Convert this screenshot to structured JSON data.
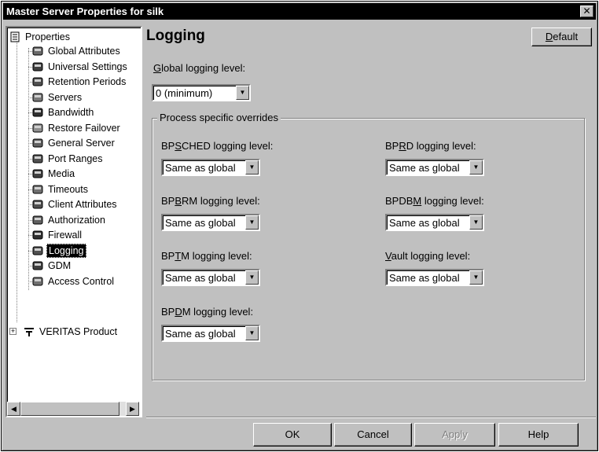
{
  "window": {
    "title": "Master Server Properties for silk",
    "close_glyph": "✕"
  },
  "tree": {
    "root": "Properties",
    "items": [
      {
        "label": "Global Attributes",
        "icon": "globe-icon"
      },
      {
        "label": "Universal Settings",
        "icon": "settings-icon"
      },
      {
        "label": "Retention Periods",
        "icon": "clock-icon"
      },
      {
        "label": "Servers",
        "icon": "server-icon"
      },
      {
        "label": "Bandwidth",
        "icon": "bandwidth-icon"
      },
      {
        "label": "Restore Failover",
        "icon": "restore-icon"
      },
      {
        "label": "General Server",
        "icon": "server-icon"
      },
      {
        "label": "Port Ranges",
        "icon": "port-icon"
      },
      {
        "label": "Media",
        "icon": "media-icon"
      },
      {
        "label": "Timeouts",
        "icon": "timer-icon"
      },
      {
        "label": "Client Attributes",
        "icon": "client-icon"
      },
      {
        "label": "Authorization",
        "icon": "key-icon"
      },
      {
        "label": "Firewall",
        "icon": "firewall-icon"
      },
      {
        "label": "Logging",
        "icon": "log-icon",
        "selected": true
      },
      {
        "label": "GDM",
        "icon": "gdm-icon"
      },
      {
        "label": "Access Control",
        "icon": "lock-icon"
      }
    ],
    "veritas": "VERITAS Product",
    "expander": "+"
  },
  "page": {
    "heading": "Logging",
    "default_button": {
      "pre": "",
      "accel": "D",
      "post": "efault"
    },
    "global_label": {
      "pre": "",
      "accel": "G",
      "post": "lobal logging level:"
    },
    "global_value": "0 (minimum)",
    "group_title": "Process specific overrides",
    "overrides": [
      {
        "pre": "BP",
        "accel": "S",
        "post": "CHED logging level:",
        "value": "Same as global"
      },
      {
        "pre": "BP",
        "accel": "R",
        "post": "D logging level:",
        "value": "Same as global"
      },
      {
        "pre": "BP",
        "accel": "B",
        "post": "RM logging level:",
        "value": "Same as global"
      },
      {
        "pre": "BPDB",
        "accel": "M",
        "post": " logging level:",
        "value": "Same as global"
      },
      {
        "pre": "BP",
        "accel": "T",
        "post": "M logging level:",
        "value": "Same as global"
      },
      {
        "pre": "",
        "accel": "V",
        "post": "ault logging level:",
        "value": "Same as global"
      },
      {
        "pre": "BP",
        "accel": "D",
        "post": "M logging level:",
        "value": "Same as global"
      }
    ]
  },
  "footer": {
    "ok": "OK",
    "cancel": "Cancel",
    "apply": "Apply",
    "help": "Help"
  },
  "glyphs": {
    "dropdown": "▼",
    "left": "◀",
    "right": "▶"
  }
}
